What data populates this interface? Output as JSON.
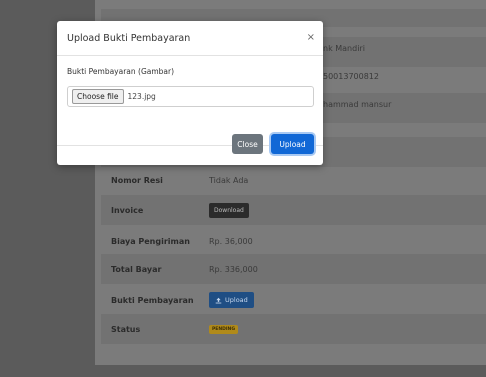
{
  "modal": {
    "title": "Upload Bukti Pembayaran",
    "close_glyph": "×",
    "field_label": "Bukti Pembayaran (Gambar)",
    "choose_file_label": "Choose file",
    "file_name": "123.jpg",
    "close_button": "Close",
    "upload_button": "Upload"
  },
  "background": {
    "partial_values": [
      "nk Mandiri",
      "50013700812",
      "hammad mansur"
    ],
    "rows": [
      {
        "label": "Nomor Resi",
        "value": "Tidak Ada"
      },
      {
        "label": "Invoice",
        "button": "Download"
      },
      {
        "label": "Biaya Pengiriman",
        "value": "Rp. 36,000"
      },
      {
        "label": "Total Bayar",
        "value": "Rp. 336,000"
      },
      {
        "label": "Bukti Pembayaran",
        "button": "Upload",
        "icon": "upload-icon"
      },
      {
        "label": "Status",
        "badge": "PENDING"
      }
    ]
  },
  "colors": {
    "primary": "#1168d6",
    "secondary": "#6c757d",
    "warning": "#b08a1a"
  }
}
